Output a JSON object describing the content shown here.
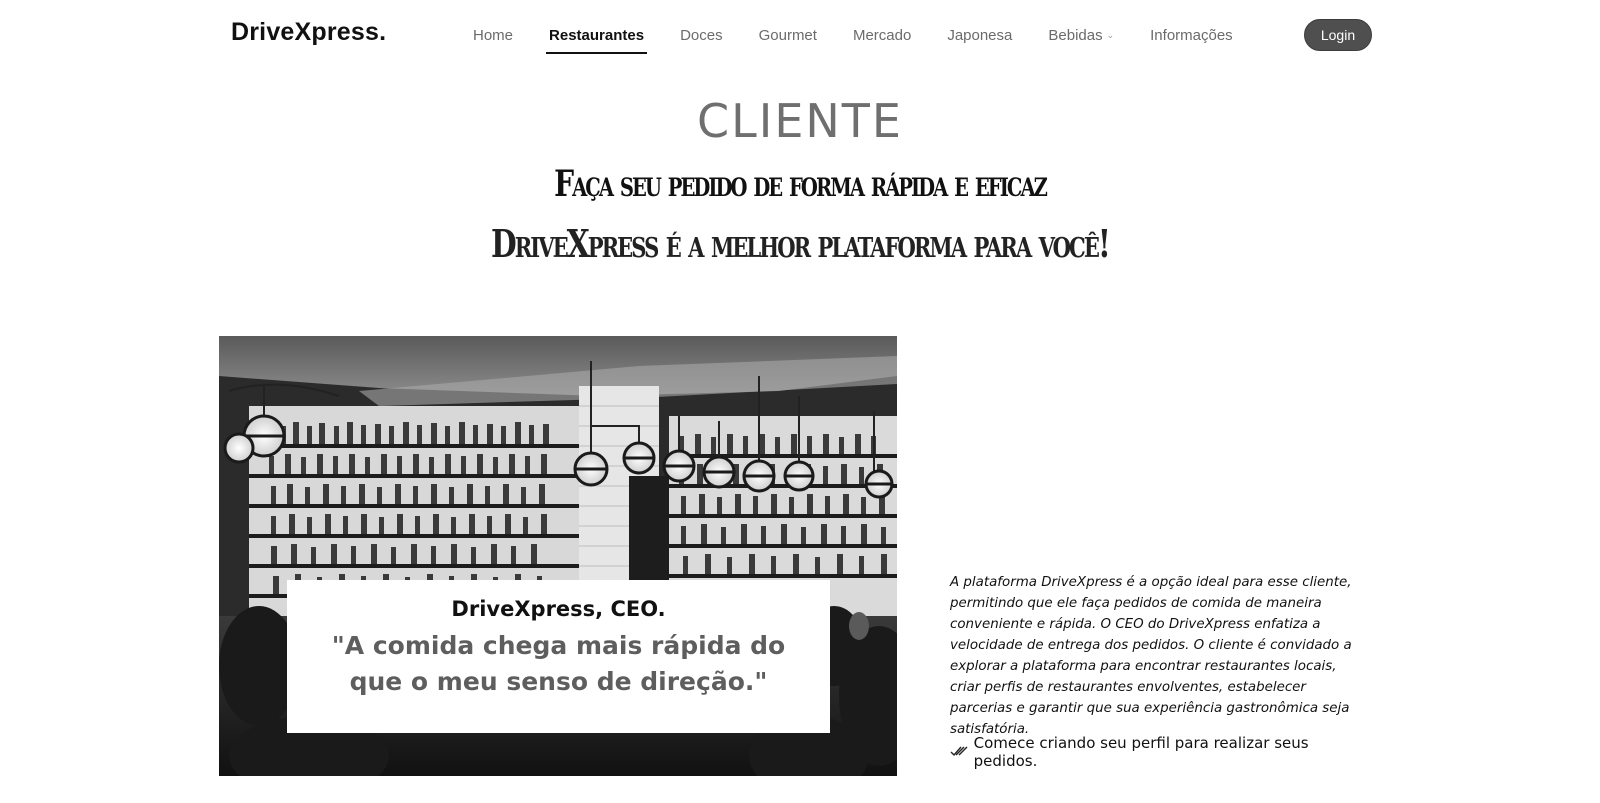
{
  "brand": {
    "name": "DriveXpress",
    "dot": "."
  },
  "nav": {
    "items": [
      {
        "label": "Home",
        "active": false
      },
      {
        "label": "Restaurantes",
        "active": true
      },
      {
        "label": "Doces",
        "active": false
      },
      {
        "label": "Gourmet",
        "active": false
      },
      {
        "label": "Mercado",
        "active": false
      },
      {
        "label": "Japonesa",
        "active": false
      },
      {
        "label": "Bebidas",
        "active": false,
        "dropdown": true
      },
      {
        "label": "Informações",
        "active": false
      }
    ],
    "login_label": "Login"
  },
  "hero": {
    "title": "CLIENTE",
    "subtitle1": "Faça seu pedido de forma rápida e eficaz",
    "subtitle2": "DriveXpress é a melhor plataforma para você!"
  },
  "quote": {
    "author": "DriveXpress, CEO.",
    "text": "\"A comida chega mais rápida do que o meu senso de direção.\""
  },
  "description": {
    "paragraph": "A plataforma DriveXpress é a opção ideal para esse cliente, permitindo que ele faça pedidos de comida de maneira conveniente e rápida. O CEO do DriveXpress enfatiza a velocidade de entrega dos pedidos. O cliente é convidado a explorar a plataforma para encontrar restaurantes locais, criar perfis de restaurantes envolventes, estabelecer parcerias e garantir que sua experiência gastronômica seja satisfatória.",
    "cta_icon": "double-check-icon",
    "cta": "Comece criando seu perfil para realizar seus pedidos."
  },
  "colors": {
    "login_bg": "#4f4f4f",
    "nav_inactive": "#6b6b6b",
    "hero_title": "#6f6f6f",
    "quote_text": "#5e5e5e"
  }
}
